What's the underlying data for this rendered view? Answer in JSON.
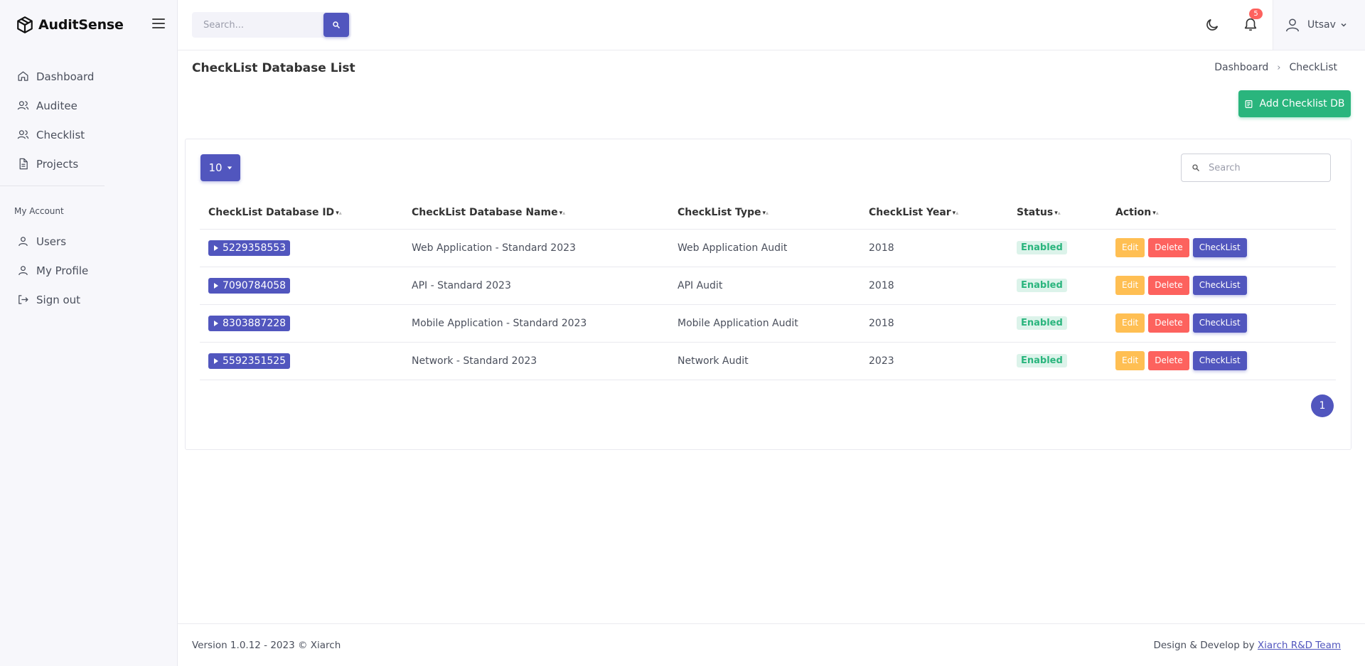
{
  "brand": {
    "name": "AuditSense"
  },
  "sidebar": {
    "items": [
      {
        "label": "Dashboard",
        "icon": "home-icon"
      },
      {
        "label": "Auditee",
        "icon": "users-icon"
      },
      {
        "label": "Checklist",
        "icon": "users-icon"
      },
      {
        "label": "Projects",
        "icon": "file-icon"
      }
    ],
    "section_title": "My Account",
    "account_items": [
      {
        "label": "Users",
        "icon": "user-icon"
      },
      {
        "label": "My Profile",
        "icon": "user-icon"
      },
      {
        "label": "Sign out",
        "icon": "sign-out-icon"
      }
    ]
  },
  "header": {
    "search_placeholder": "Search...",
    "notification_count": "5",
    "user_name": "Utsav"
  },
  "page": {
    "title": "CheckList Database List",
    "breadcrumb": [
      "Dashboard",
      "CheckList"
    ],
    "add_button": "Add Checklist DB"
  },
  "table": {
    "page_length": "10",
    "search_placeholder": "Search",
    "columns": [
      "CheckList Database ID",
      "CheckList Database Name",
      "CheckList Type",
      "CheckList Year",
      "Status",
      "Action"
    ],
    "rows": [
      {
        "id": "5229358553",
        "name": "Web Application - Standard 2023",
        "type": "Web Application Audit",
        "year": "2018",
        "status": "Enabled"
      },
      {
        "id": "7090784058",
        "name": "API - Standard 2023",
        "type": "API Audit",
        "year": "2018",
        "status": "Enabled"
      },
      {
        "id": "8303887228",
        "name": "Mobile Application - Standard 2023",
        "type": "Mobile Application Audit",
        "year": "2018",
        "status": "Enabled"
      },
      {
        "id": "5592351525",
        "name": "Network - Standard 2023",
        "type": "Network Audit",
        "year": "2023",
        "status": "Enabled"
      }
    ],
    "actions": {
      "edit": "Edit",
      "delete": "Delete",
      "checklist": "CheckList"
    },
    "current_page": "1"
  },
  "footer": {
    "version": "Version 1.0.12 - 2023 © Xiarch",
    "credit_prefix": "Design & Develop by",
    "credit_link": "Xiarch R&D Team"
  },
  "colors": {
    "primary": "#5156be",
    "success": "#2ab57d",
    "warning": "#ffbf53",
    "danger": "#fd625e"
  }
}
